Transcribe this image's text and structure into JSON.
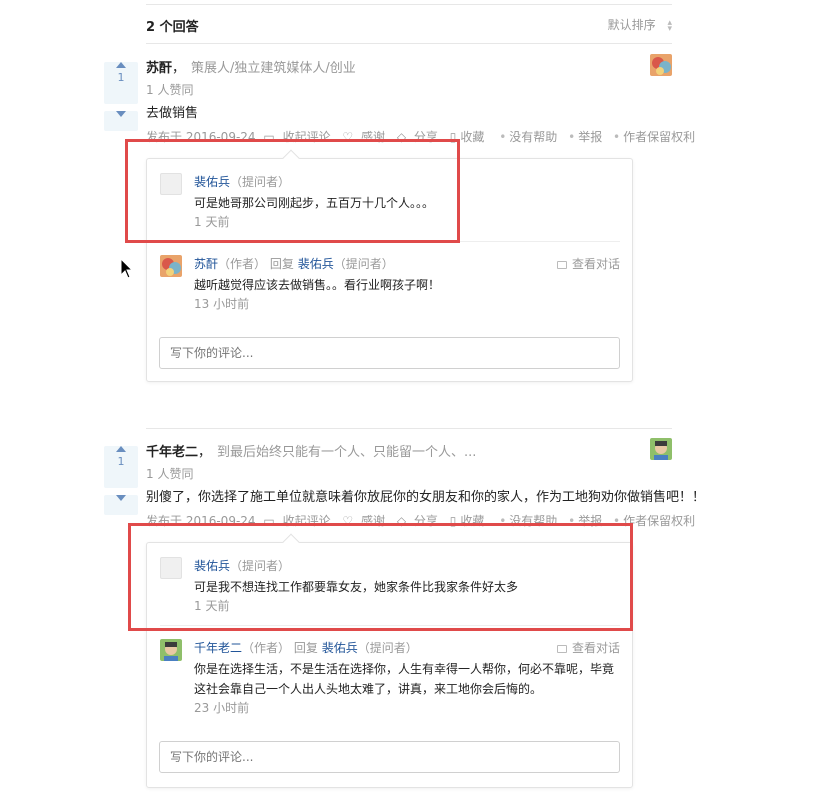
{
  "header": {
    "answers_count": "2 个回答",
    "sort_label": "默认排序"
  },
  "answers": [
    {
      "vote_count": "1",
      "author": "苏酐",
      "bio": "策展人/独立建筑媒体人/创业",
      "votes_text": "1 人赞同",
      "content": "去做销售",
      "meta": {
        "published": "发布于 2016-09-24",
        "collapse": "收起评论",
        "thanks": "感谢",
        "share": "分享",
        "favorite": "收藏",
        "no_help": "没有帮助",
        "report": "举报",
        "rights": "作者保留权利"
      },
      "comments": [
        {
          "user": "裴佑兵",
          "role": "（提问者）",
          "text": "可是她哥那公司刚起步，五百万十几个人。。。",
          "time": "1 天前"
        },
        {
          "user": "苏酐",
          "role": "（作者）",
          "reply_word": "回复",
          "reply_to": "裴佑兵",
          "reply_role": "（提问者）",
          "text": "越听越觉得应该去做销售。。看行业啊孩子啊！",
          "time": "13 小时前",
          "dialog": "查看对话"
        }
      ],
      "input_placeholder": "写下你的评论..."
    },
    {
      "vote_count": "1",
      "author": "千年老二",
      "bio": "到最后始终只能有一个人、只能留一个人、...",
      "votes_text": "1 人赞同",
      "content": "别傻了，你选择了施工单位就意味着你放屁你的女朋友和你的家人，作为工地狗劝你做销售吧！！",
      "meta": {
        "published": "发布于 2016-09-24",
        "collapse": "收起评论",
        "thanks": "感谢",
        "share": "分享",
        "favorite": "收藏",
        "no_help": "没有帮助",
        "report": "举报",
        "rights": "作者保留权利"
      },
      "comments": [
        {
          "user": "裴佑兵",
          "role": "（提问者）",
          "text": "可是我不想连找工作都要靠女友，她家条件比我家条件好太多",
          "time": "1 天前"
        },
        {
          "user": "千年老二",
          "role": "（作者）",
          "reply_word": "回复",
          "reply_to": "裴佑兵",
          "reply_role": "（提问者）",
          "text": "你是在选择生活，不是生活在选择你，人生有幸得一人帮你，何必不靠呢，毕竟这社会靠自己一个人出人头地太难了，讲真，来工地你会后悔的。",
          "time": "23 小时前",
          "dialog": "查看对话"
        }
      ],
      "input_placeholder": "写下你的评论..."
    }
  ],
  "colors": {
    "highlight": "#e04a4a",
    "vote_bg": "#eff6fa",
    "vote_fg": "#698ebf",
    "link": "#225599"
  }
}
